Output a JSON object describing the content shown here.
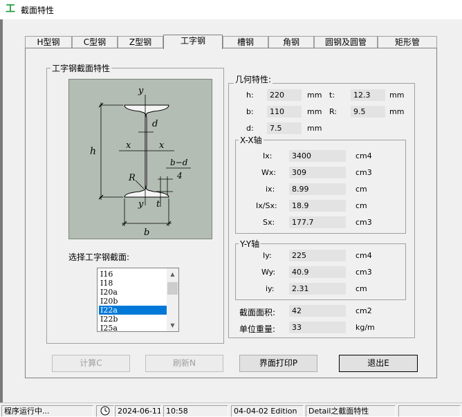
{
  "window": {
    "title": "截面特性",
    "app_icon_glyph": "工"
  },
  "tabs": [
    {
      "label": "H型钢",
      "active": false
    },
    {
      "label": "C型钢",
      "active": false
    },
    {
      "label": "Z型钢",
      "active": false
    },
    {
      "label": "工字钢",
      "active": true
    },
    {
      "label": "槽钢",
      "active": false
    },
    {
      "label": "角钢",
      "active": false
    },
    {
      "label": "圆钢及圆管",
      "active": false
    },
    {
      "label": "矩形管",
      "active": false
    }
  ],
  "left_group": {
    "title": "工字钢截面特性",
    "select_label": "选择工字钢截面:",
    "diagram_labels": {
      "y_top": "y",
      "y_bottom": "y",
      "x_left": "x",
      "x_right": "x",
      "d": "d",
      "h": "h",
      "R": "R",
      "t": "t",
      "b": "b",
      "bd_num": "b−d",
      "bd_den": "4"
    },
    "sections": [
      "I16",
      "I18",
      "I20a",
      "I20b",
      "I22a",
      "I22b",
      "I25a"
    ],
    "selected_index": 4
  },
  "geometry": {
    "title": "几何特性:",
    "h_label": "h:",
    "h_value": "220",
    "h_unit": "mm",
    "t_label": "t:",
    "t_value": "12.3",
    "t_unit": "mm",
    "b_label": "b:",
    "b_value": "110",
    "b_unit": "mm",
    "R_label": "R:",
    "R_value": "9.5",
    "R_unit": "mm",
    "d_label": "d:",
    "d_value": "7.5",
    "d_unit": "mm"
  },
  "xx_axis": {
    "title": "X-X轴",
    "rows": [
      {
        "label": "Ix:",
        "value": "3400",
        "unit": "cm4"
      },
      {
        "label": "Wx:",
        "value": "309",
        "unit": "cm3"
      },
      {
        "label": "ix:",
        "value": "8.99",
        "unit": "cm"
      },
      {
        "label": "Ix/Sx:",
        "value": "18.9",
        "unit": "cm"
      },
      {
        "label": "Sx:",
        "value": "177.7",
        "unit": "cm3"
      }
    ]
  },
  "yy_axis": {
    "title": "Y-Y轴",
    "rows": [
      {
        "label": "Iy:",
        "value": "225",
        "unit": "cm4"
      },
      {
        "label": "Wy:",
        "value": "40.9",
        "unit": "cm3"
      },
      {
        "label": "iy:",
        "value": "2.31",
        "unit": "cm"
      }
    ]
  },
  "area": {
    "label": "截面面积:",
    "value": "42",
    "unit": "cm2"
  },
  "weight": {
    "label": "单位重量:",
    "value": "33",
    "unit": "kg/m"
  },
  "buttons": {
    "calc": "计算C",
    "refresh": "刷新N",
    "print": "界面打印P",
    "exit": "退出E"
  },
  "status": {
    "state": "程序运行中...",
    "date": "2024-06-11",
    "time": "10:58",
    "edition": "04-04-02 Edition",
    "module": "Detail之截面特性"
  }
}
